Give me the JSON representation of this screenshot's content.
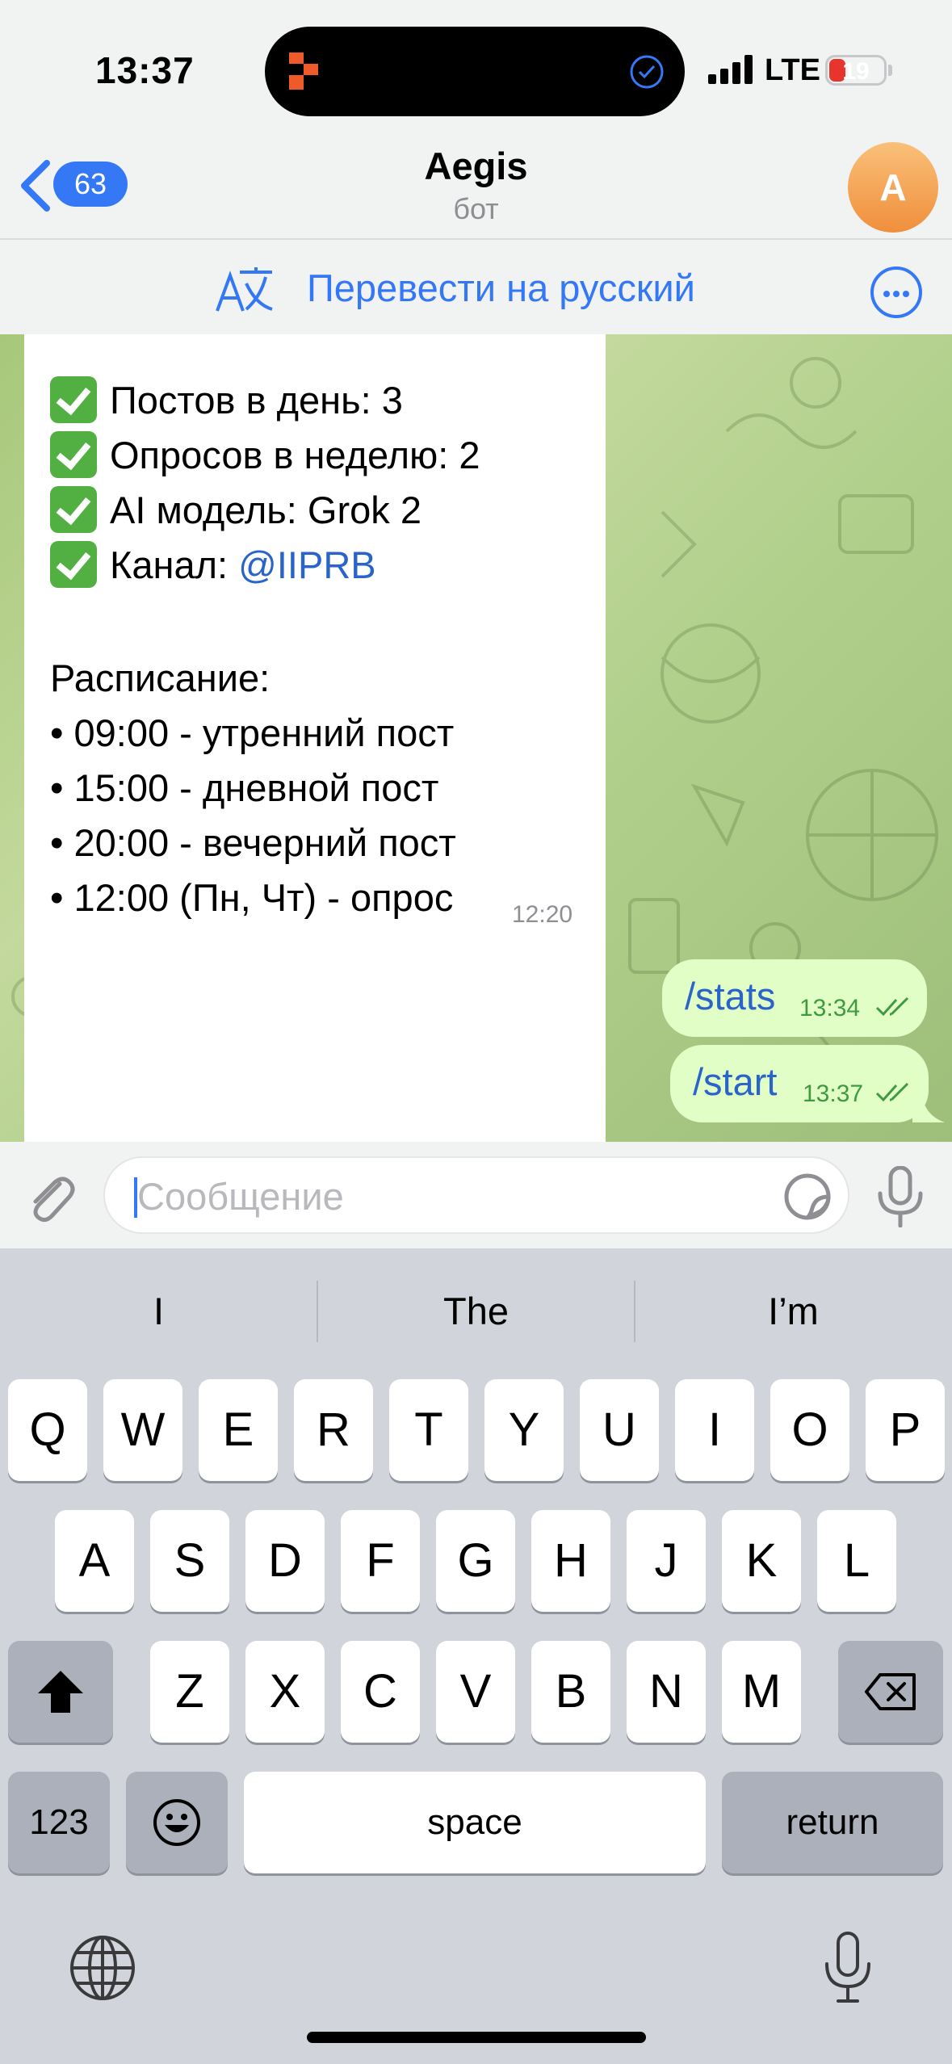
{
  "status_bar": {
    "time": "13:37",
    "network": "LTE",
    "battery_level": "19"
  },
  "header": {
    "back_count": "63",
    "title": "Aegis",
    "subtitle": "бот",
    "avatar_letter": "A"
  },
  "translate_bar": {
    "label": "Перевести на русский"
  },
  "messages": {
    "incoming": {
      "lines": {
        "posts": "Постов в день: 3",
        "polls": "Опросов в неделю: 2",
        "model": "AI модель: Grok 2",
        "channel_label": "Канал: ",
        "channel_link": "@IIPRB",
        "schedule_title": "Расписание:",
        "s1": "• 09:00 - утренний пост",
        "s2": "• 15:00 - дневной пост",
        "s3": "• 20:00 - вечерний пост",
        "s4": "• 12:00 (Пн, Чт) - опрос"
      },
      "time": "12:20"
    },
    "outgoing": [
      {
        "text": "/stats",
        "time": "13:34"
      },
      {
        "text": "/start",
        "time": "13:37"
      }
    ]
  },
  "input": {
    "placeholder": "Сообщение",
    "value": ""
  },
  "keyboard": {
    "suggestions": [
      "I",
      "The",
      "I’m"
    ],
    "row1": [
      "Q",
      "W",
      "E",
      "R",
      "T",
      "Y",
      "U",
      "I",
      "O",
      "P"
    ],
    "row2": [
      "A",
      "S",
      "D",
      "F",
      "G",
      "H",
      "J",
      "K",
      "L"
    ],
    "row3": [
      "Z",
      "X",
      "C",
      "V",
      "B",
      "N",
      "M"
    ],
    "numbers_key": "123",
    "space_key": "space",
    "return_key": "return"
  },
  "colors": {
    "accent": "#3478f6",
    "outgoing_bubble": "#e1fec6",
    "chat_bg": "#b0cf8b",
    "check_green": "#52b043"
  }
}
